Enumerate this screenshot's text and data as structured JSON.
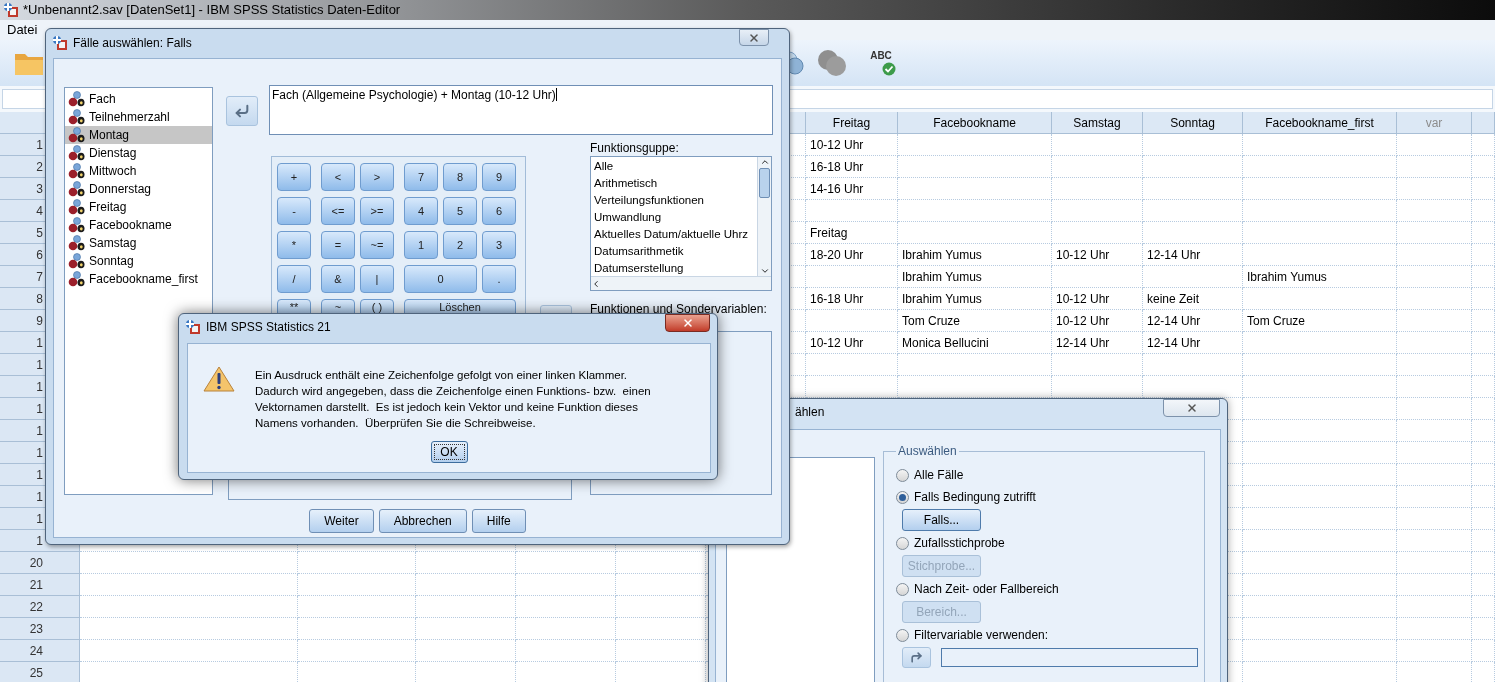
{
  "editor": {
    "title": "*Unbenannt2.sav [DatenSet1] - IBM SPSS Statistics Daten-Editor",
    "menu": [
      "Datei"
    ],
    "spellcheck_label": "ABC",
    "columns": [
      {
        "header": "Freitag",
        "kind": "variable"
      },
      {
        "header": "Facebookname",
        "kind": "variable"
      },
      {
        "header": "Samstag",
        "kind": "variable"
      },
      {
        "header": "Sonntag",
        "kind": "variable"
      },
      {
        "header": "Facebookname_first",
        "kind": "variable"
      },
      {
        "header": "var",
        "kind": "empty"
      }
    ],
    "rows": [
      {
        "number": "1",
        "cells": [
          "10-12 Uhr"
        ]
      },
      {
        "number": "2",
        "cells": [
          "16-18 Uhr"
        ]
      },
      {
        "number": "3",
        "cells": [
          "14-16 Uhr"
        ]
      },
      {
        "number": "4"
      },
      {
        "number": "5",
        "cells": [
          "Freitag"
        ]
      },
      {
        "number": "6",
        "cells": [
          "18-20 Uhr",
          "Ibrahim Yumus",
          "10-12 Uhr",
          "12-14 Uhr"
        ]
      },
      {
        "number": "7",
        "cells": [
          null,
          "Ibrahim Yumus",
          null,
          null,
          "Ibrahim Yumus"
        ]
      },
      {
        "number": "8",
        "cells": [
          "16-18 Uhr",
          "Ibrahim Yumus",
          "10-12 Uhr",
          "keine Zeit"
        ]
      },
      {
        "number": "9",
        "cells": [
          null,
          "Tom Cruze",
          "10-12 Uhr",
          "12-14 Uhr",
          "Tom Cruze"
        ]
      },
      {
        "number": "1",
        "cells": [
          "10-12 Uhr",
          "Monica Bellucini",
          "12-14 Uhr",
          "12-14 Uhr"
        ]
      },
      {
        "number": "1"
      },
      {
        "number": "1"
      },
      {
        "number": "1"
      },
      {
        "number": "1"
      },
      {
        "number": "1"
      },
      {
        "number": "1"
      },
      {
        "number": "1"
      },
      {
        "number": "1"
      },
      {
        "number": "1"
      },
      {
        "number": "20"
      },
      {
        "number": "21"
      },
      {
        "number": "22"
      },
      {
        "number": "23"
      },
      {
        "number": "24"
      },
      {
        "number": "25"
      }
    ]
  },
  "select_cases_dialog": {
    "title": "ählen",
    "group_label": "Auswählen",
    "options": [
      {
        "kind": "radio",
        "label": "Alle Fälle",
        "selected": false
      },
      {
        "kind": "radio",
        "label": "Falls Bedingung zutrifft",
        "selected": true
      },
      {
        "kind": "button",
        "label": "Falls...",
        "disabled": false
      },
      {
        "kind": "radio",
        "label": "Zufallsstichprobe",
        "selected": false
      },
      {
        "kind": "button",
        "label": "Stichprobe...",
        "disabled": true
      },
      {
        "kind": "radio",
        "label": "Nach Zeit- oder Fallbereich",
        "selected": false
      },
      {
        "kind": "button",
        "label": "Bereich...",
        "disabled": true
      },
      {
        "kind": "radio",
        "label": "Filtervariable verwenden:",
        "selected": false
      },
      {
        "kind": "field"
      }
    ]
  },
  "if_dialog": {
    "title": "Fälle auswählen: Falls",
    "variables": [
      {
        "name": "Fach",
        "selected": false
      },
      {
        "name": "Teilnehmerzahl",
        "selected": false
      },
      {
        "name": "Montag",
        "selected": true
      },
      {
        "name": "Dienstag",
        "selected": false
      },
      {
        "name": "Mittwoch",
        "selected": false
      },
      {
        "name": "Donnerstag",
        "selected": false
      },
      {
        "name": "Freitag",
        "selected": false
      },
      {
        "name": "Facebookname",
        "selected": false
      },
      {
        "name": "Samstag",
        "selected": false
      },
      {
        "name": "Sonntag",
        "selected": false
      },
      {
        "name": "Facebookname_first",
        "selected": false
      }
    ],
    "expression": "Fach (Allgemeine Psychologie) + Montag (10-12 Uhr)",
    "keypad": [
      [
        {
          "label": "+"
        },
        {
          "label": "<"
        },
        {
          "label": ">"
        },
        {
          "label": "7"
        },
        {
          "label": "8"
        },
        {
          "label": "9"
        }
      ],
      [
        {
          "label": "-"
        },
        {
          "label": "<="
        },
        {
          "label": ">="
        },
        {
          "label": "4"
        },
        {
          "label": "5"
        },
        {
          "label": "6"
        }
      ],
      [
        {
          "label": "*"
        },
        {
          "label": "="
        },
        {
          "label": "~="
        },
        {
          "label": "1"
        },
        {
          "label": "2"
        },
        {
          "label": "3"
        }
      ],
      [
        {
          "label": "/"
        },
        {
          "label": "&"
        },
        {
          "label": "|"
        },
        {
          "label": "0"
        },
        {
          "label": "."
        }
      ],
      [
        {
          "label": "**"
        },
        {
          "label": "~"
        },
        {
          "label": "( )"
        },
        {
          "label": "Löschen"
        }
      ]
    ],
    "function_group_label": "Funktionsguppe:",
    "function_groups": [
      "Alle",
      "Arithmetisch",
      "Verteilungsfunktionen",
      "Umwandlung",
      "Aktuelles Datum/aktuelle Uhrz",
      "Datumsarithmetik",
      "Datumserstellung"
    ],
    "functions_label": "Funktionen und Sondervariablen:",
    "buttons": [
      "Weiter",
      "Abbrechen",
      "Hilfe"
    ]
  },
  "message_box": {
    "title": "IBM SPSS Statistics 21",
    "message": "Ein Ausdruck enthält eine Zeichenfolge gefolgt von einer linken Klammer.\nDadurch wird angegeben, dass die Zeichenfolge einen Funktions- bzw.  einen\nVektornamen darstellt.  Es ist jedoch kein Vektor und keine Funktion dieses\nNamens vorhanden.  Überprüfen Sie die Schreibweise.",
    "button": "OK"
  }
}
